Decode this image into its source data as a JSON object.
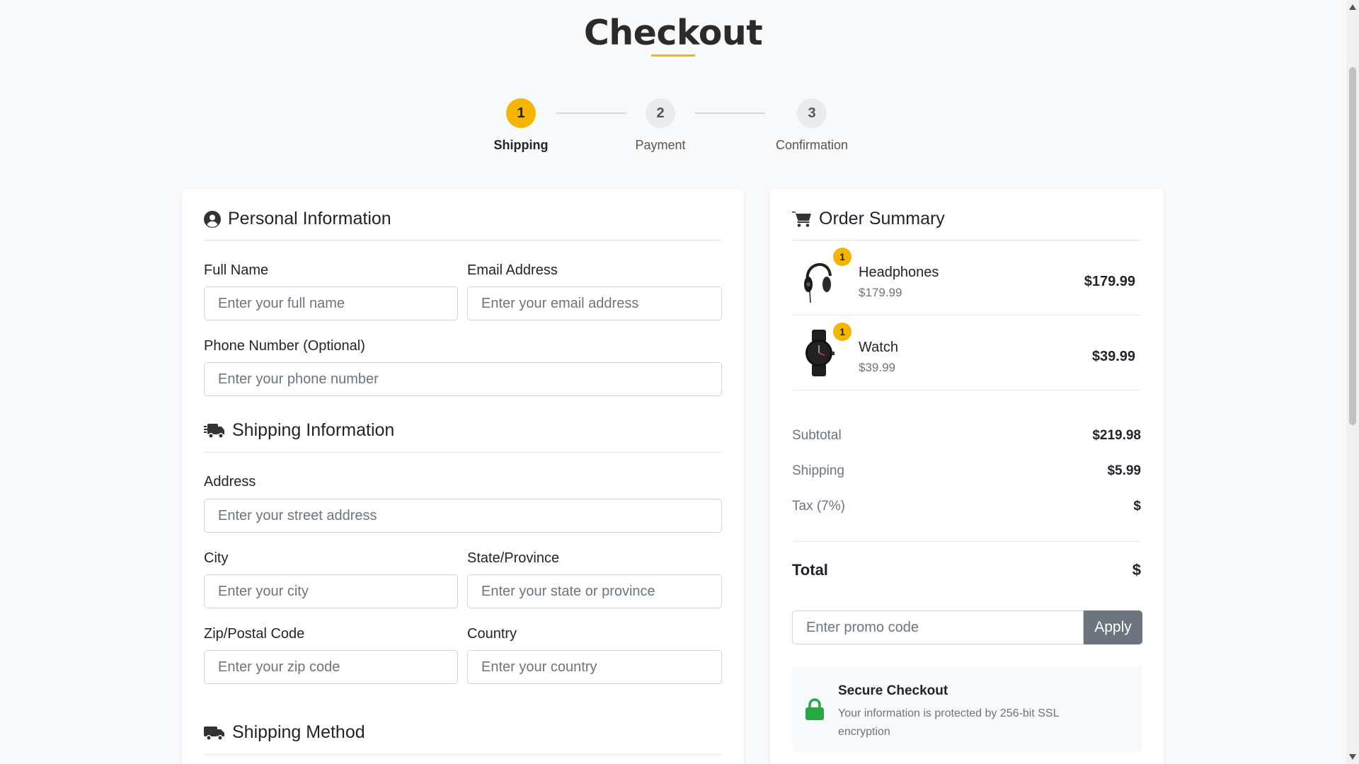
{
  "page": {
    "title": "Checkout"
  },
  "steps": [
    {
      "number": "1",
      "label": "Shipping",
      "active": true
    },
    {
      "number": "2",
      "label": "Payment",
      "active": false
    },
    {
      "number": "3",
      "label": "Confirmation",
      "active": false
    }
  ],
  "personal": {
    "title": "Personal Information",
    "icon": "user-circle-icon",
    "full_name": {
      "label": "Full Name",
      "placeholder": "Enter your full name",
      "value": ""
    },
    "email": {
      "label": "Email Address",
      "placeholder": "Enter your email address",
      "value": ""
    },
    "phone": {
      "label": "Phone Number (Optional)",
      "placeholder": "Enter your phone number",
      "value": ""
    }
  },
  "shipping_info": {
    "title": "Shipping Information",
    "icon": "shipping-fast-icon",
    "address": {
      "label": "Address",
      "placeholder": "Enter your street address",
      "value": ""
    },
    "city": {
      "label": "City",
      "placeholder": "Enter your city",
      "value": ""
    },
    "state": {
      "label": "State/Province",
      "placeholder": "Enter your state or province",
      "value": ""
    },
    "zip": {
      "label": "Zip/Postal Code",
      "placeholder": "Enter your zip code",
      "value": ""
    },
    "country": {
      "label": "Country",
      "placeholder": "Enter your country",
      "value": ""
    }
  },
  "shipping_method": {
    "title": "Shipping Method",
    "icon": "truck-icon"
  },
  "summary": {
    "title": "Order Summary",
    "icon": "cart-icon",
    "items": [
      {
        "name": "Headphones",
        "unit_price": "$179.99",
        "quantity": "1",
        "price": "$179.99",
        "icon": "headphones-icon"
      },
      {
        "name": "Watch",
        "unit_price": "$39.99",
        "quantity": "1",
        "price": "$39.99",
        "icon": "watch-icon"
      }
    ],
    "subtotal": {
      "label": "Subtotal",
      "value": "$219.98"
    },
    "shipping": {
      "label": "Shipping",
      "value": "$5.99"
    },
    "tax": {
      "label": "Tax (7%)",
      "value": "$"
    },
    "total": {
      "label": "Total",
      "value": "$"
    },
    "promo": {
      "placeholder": "Enter promo code",
      "button": "Apply"
    },
    "secure": {
      "title": "Secure Checkout",
      "text": "Your information is protected by 256-bit SSL encryption",
      "icon": "lock-icon"
    }
  },
  "colors": {
    "accent": "#f4b400",
    "muted": "#6c757d",
    "secure_lock": "#28a745"
  }
}
